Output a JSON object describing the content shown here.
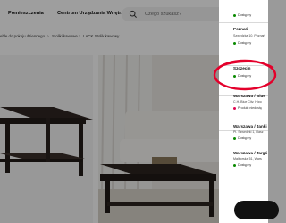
{
  "header": {
    "nav": [
      "Pomieszczenia",
      "Centrum Urządzania Wnętrz"
    ],
    "search": {
      "placeholder": "Czego szukasz?"
    }
  },
  "breadcrumb": [
    "eble do pokoju dziennego",
    "Stoliki kawowe",
    "LACK Stolik kawowy"
  ],
  "stores": [
    {
      "name": "",
      "address": "",
      "status": "Dostępny",
      "status_color": "#0a8a00"
    },
    {
      "name": "Poznań",
      "address": "Szwedzka 10, Poznań",
      "status": "Dostępny",
      "status_color": "#0a8a00"
    },
    {
      "name": "Szczecin",
      "address": "",
      "status": "Dostępny",
      "status_color": "#0a8a00"
    },
    {
      "name": "Warszawa / Blue",
      "address": "C.H. Blue City, Hipo",
      "status": "Produkt niedostę",
      "status_color": "#e00751"
    },
    {
      "name": "Warszawa / Janki",
      "address": "Pl. Szwedzki 1, Rasz",
      "status": "Dostępny",
      "status_color": "#0a8a00"
    },
    {
      "name": "Warszawa / Targó",
      "address": "Malborska 51, Wars",
      "status": "Dostępny",
      "status_color": "#0a8a00"
    }
  ],
  "colors": {
    "highlight": "#e4002b",
    "in_stock": "#0a8a00",
    "out_of_stock": "#e00751"
  }
}
